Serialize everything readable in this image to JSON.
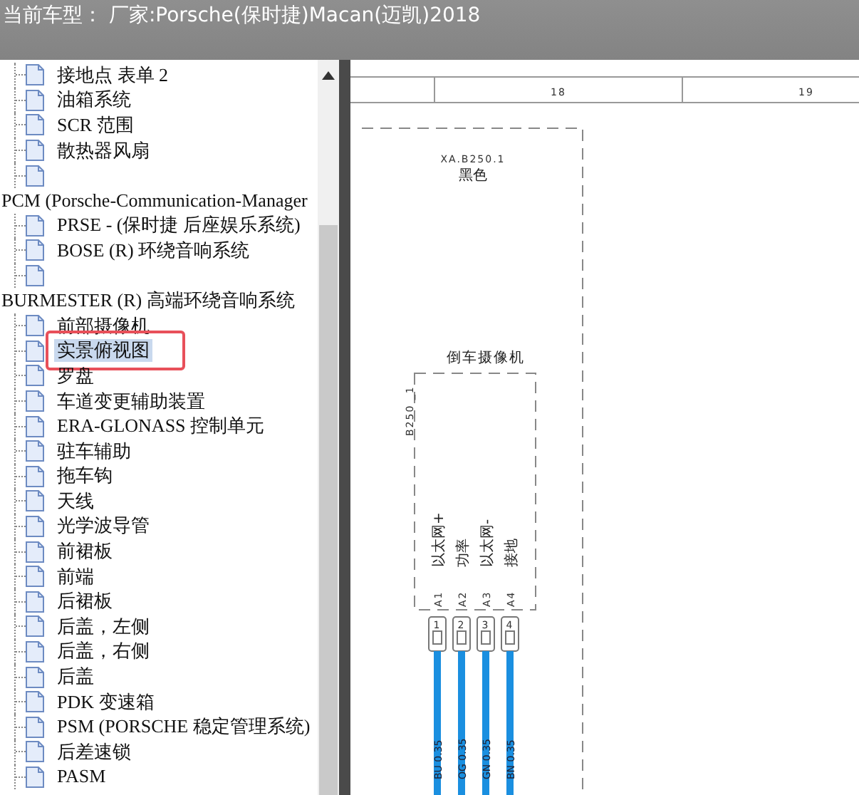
{
  "window": {
    "title": "当前车型： 厂家:Porsche(保时捷)Macan(迈凯)2018"
  },
  "tree": [
    {
      "children": [
        {
          "label": "接地点 表单 2",
          "selected": false
        },
        {
          "label": "油箱系统",
          "selected": false
        },
        {
          "label": "SCR 范围",
          "selected": false
        },
        {
          "label": "散热器风扇",
          "selected": false
        },
        {
          "selected": false
        }
      ]
    },
    {
      "label": "PCM (Porsche-Communication-Manager",
      "children": [
        {
          "label": "PRSE - (保时捷 后座娱乐系统)",
          "selected": false
        },
        {
          "label": "BOSE (R) 环绕音响系统",
          "selected": false
        },
        {
          "selected": false
        }
      ]
    },
    {
      "label": "BURMESTER (R) 高端环绕音响系统",
      "children": [
        {
          "label": "前部摄像机",
          "selected": false
        },
        {
          "label": "实景俯视图",
          "selected": true
        },
        {
          "label": "罗盘",
          "selected": false
        },
        {
          "label": "车道变更辅助装置",
          "selected": false
        },
        {
          "label": "ERA-GLONASS 控制单元",
          "selected": false
        },
        {
          "label": "驻车辅助",
          "selected": false
        },
        {
          "label": "拖车钩",
          "selected": false
        },
        {
          "label": "天线",
          "selected": false
        },
        {
          "label": "光学波导管",
          "selected": false
        },
        {
          "label": "前裙板",
          "selected": false
        },
        {
          "label": "前端",
          "selected": false
        },
        {
          "label": "后裙板",
          "selected": false
        },
        {
          "label": "后盖，左侧",
          "selected": false
        },
        {
          "label": "后盖，右侧",
          "selected": false
        },
        {
          "label": "后盖",
          "selected": false
        },
        {
          "label": "PDK 变速箱",
          "selected": false
        },
        {
          "label": "PSM (PORSCHE 稳定管理系统)",
          "selected": false
        },
        {
          "label": "后差速锁",
          "selected": false
        },
        {
          "label": "PASM",
          "selected": false
        }
      ]
    }
  ],
  "diagram": {
    "columns": [
      "18",
      "19"
    ],
    "connector": {
      "name": "XA.B250.1",
      "color_label": "黑色"
    },
    "component": {
      "name": "倒车摄像机",
      "id": "B250 _1"
    },
    "pins": [
      {
        "signal": "以太网+",
        "pin": "A1",
        "number": "1",
        "wire": "BU 0.35",
        "color": "#1a8fe0"
      },
      {
        "signal": "功率",
        "pin": "A2",
        "number": "2",
        "wire": "OG 0.35",
        "color": "#1a8fe0"
      },
      {
        "signal": "以太网-",
        "pin": "A3",
        "number": "3",
        "wire": "GN 0.35",
        "color": "#1a8fe0"
      },
      {
        "signal": "接地",
        "pin": "A4",
        "number": "4",
        "wire": "BN 0.35",
        "color": "#1a8fe0"
      }
    ]
  }
}
